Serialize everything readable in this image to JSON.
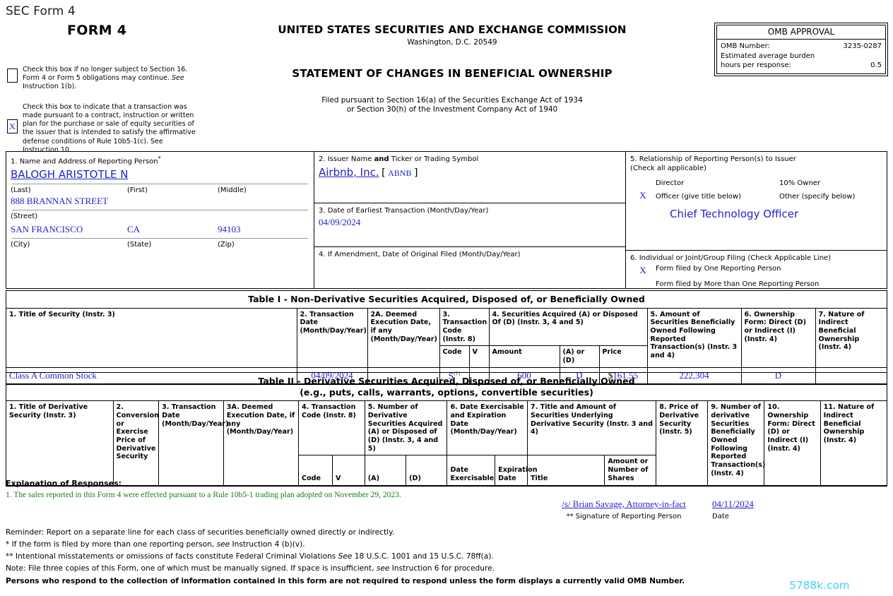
{
  "top_label": "SEC Form 4",
  "header": {
    "form_title": "FORM 4",
    "agency": "UNITED STATES SECURITIES AND EXCHANGE COMMISSION",
    "city": "Washington, D.C. 20549",
    "statement": "STATEMENT OF CHANGES IN BENEFICIAL OWNERSHIP",
    "filed_line1": "Filed pursuant to Section 16(a) of the Securities Exchange Act of 1934",
    "filed_line2": "or Section 30(h) of the Investment Company Act of 1940"
  },
  "omb": {
    "title": "OMB APPROVAL",
    "number_label": "OMB Number:",
    "number_value": "3235-0287",
    "burden_label": "Estimated average burden",
    "hours_label": "hours per response:",
    "hours_value": "0.5"
  },
  "checkboxes": {
    "box1": {
      "checked": "",
      "text": "Check this box if no longer subject to Section 16. Form 4 or Form 5 obligations may continue. See Instruction 1(b)."
    },
    "box2": {
      "checked": "X",
      "text": "Check this box to indicate that a transaction was made pursuant to a contract, instruction or written plan for the purchase or sale of equity securities of the issuer that is intended to satisfy the affirmative defense conditions of Rule 10b5-1(c). See Instruction 10."
    }
  },
  "box1": {
    "heading": "1. Name and Address of Reporting Person",
    "asterisk": "*",
    "person_name": "BALOGH ARISTOTLE N",
    "label_last": "(Last)",
    "label_first": "(First)",
    "label_middle": "(Middle)",
    "street": "888 BRANNAN STREET",
    "label_street": "(Street)",
    "city": "SAN FRANCISCO",
    "state": "CA",
    "zip": "94103",
    "label_city": "(City)",
    "label_state": "(State)",
    "label_zip": "(Zip)"
  },
  "box2": {
    "heading_pre": "2. Issuer Name ",
    "heading_bold": "and",
    "heading_post": " Ticker or Trading Symbol",
    "issuer_name": "Airbnb, Inc.",
    "bracket_open": "[",
    "ticker": "ABNB",
    "bracket_close": "]"
  },
  "box3": {
    "heading": "3. Date of Earliest Transaction (Month/Day/Year)",
    "value": "04/09/2024"
  },
  "box4": {
    "heading": "4. If Amendment, Date of Original Filed (Month/Day/Year)",
    "value": ""
  },
  "box5": {
    "heading_line1": "5. Relationship of Reporting Person(s) to Issuer",
    "heading_line2": "(Check all applicable)",
    "director_label": "Director",
    "director_x": "",
    "owner10_label": "10% Owner",
    "owner10_x": "",
    "officer_label": "Officer (give title below)",
    "officer_x": "X",
    "other_label": "Other (specify below)",
    "other_x": "",
    "officer_title": "Chief Technology Officer"
  },
  "box6": {
    "heading": "6. Individual or Joint/Group Filing (Check Applicable Line)",
    "one_x": "X",
    "one_label": "Form filed by One Reporting Person",
    "more_x": "",
    "more_label": "Form filed by More than One Reporting Person"
  },
  "table1": {
    "title": "Table I - Non-Derivative Securities Acquired, Disposed of, or Beneficially Owned",
    "headers": {
      "c1": "1. Title of Security (Instr. 3)",
      "c2": "2. Transaction Date (Month/Day/Year)",
      "c2a": "2A. Deemed Execution Date, if any (Month/Day/Year)",
      "c3": "3. Transaction Code (Instr. 8)",
      "c3_code": "Code",
      "c3_v": "V",
      "c4": "4. Securities Acquired (A) or Disposed Of (D) (Instr. 3, 4 and 5)",
      "c4_amount": "Amount",
      "c4_ad": "(A) or (D)",
      "c4_price": "Price",
      "c5": "5. Amount of Securities Beneficially Owned Following Reported Transaction(s) (Instr. 3 and 4)",
      "c6": "6. Ownership Form: Direct (D) or Indirect (I) (Instr. 4)",
      "c7": "7. Nature of Indirect Beneficial Ownership (Instr. 4)"
    },
    "rows": [
      {
        "security": "Class A Common Stock",
        "date": "04/09/2024",
        "deemed_date": "",
        "code": "S",
        "code_footnote": "(1)",
        "v": "",
        "amount": "600",
        "ad": "D",
        "price_symbol": "$",
        "price": "161.55",
        "owned_after": "222,304",
        "ownership_form": "D",
        "indirect_nature": ""
      }
    ]
  },
  "table2": {
    "title_line1": "Table II - Derivative Securities Acquired, Disposed of, or Beneficially Owned",
    "title_line2": "(e.g., puts, calls, warrants, options, convertible securities)",
    "headers": {
      "c1": "1. Title of Derivative Security (Instr. 3)",
      "c2": "2. Conversion or Exercise Price of Derivative Security",
      "c3": "3. Transaction Date (Month/Day/Year)",
      "c3a": "3A. Deemed Execution Date, if any (Month/Day/Year)",
      "c4": "4. Transaction Code (Instr. 8)",
      "c4_code": "Code",
      "c4_v": "V",
      "c5": "5. Number of Derivative Securities Acquired (A) or Disposed of (D) (Instr. 3, 4 and 5)",
      "c5_a": "(A)",
      "c5_d": "(D)",
      "c6": "6. Date Exercisable and Expiration Date (Month/Day/Year)",
      "c6_exercisable": "Date Exercisable",
      "c6_expiration": "Expiration Date",
      "c7": "7. Title and Amount of Securities Underlying Derivative Security (Instr. 3 and 4)",
      "c7_title": "Title",
      "c7_amount": "Amount or Number of Shares",
      "c8": "8. Price of Derivative Security (Instr. 5)",
      "c9": "9. Number of derivative Securities Beneficially Owned Following Reported Transaction(s) (Instr. 4)",
      "c10": "10. Ownership Form: Direct (D) or Indirect (I) (Instr. 4)",
      "c11": "11. Nature of Indirect Beneficial Ownership (Instr. 4)"
    },
    "rows": []
  },
  "footer": {
    "explanation_title": "Explanation of Responses:",
    "explanations": [
      "1. The sales reported in this Form 4 were effected pursuant to a Rule 10b5-1 trading plan adopted on November 29, 2023."
    ],
    "signature": "/s/ Brian Savage, Attorney-in-fact",
    "signature_date": "04/11/2024",
    "signature_label": "** Signature of Reporting Person",
    "date_label": "Date",
    "reminder": "Reminder: Report on a separate line for each class of securities beneficially owned directly or indirectly.",
    "note1_pre": "* If the form is filed by more than one reporting person, ",
    "note1_em": "see",
    "note1_post": " Instruction 4 (b)(v).",
    "note2_pre": "** Intentional misstatements or omissions of facts constitute Federal Criminal Violations ",
    "note2_em": "See",
    "note2_post": " 18 U.S.C. 1001 and 15 U.S.C. 78ff(a).",
    "note3_pre": "Note: File three copies of this Form, one of which must be manually signed. If space is insufficient, ",
    "note3_em": "see",
    "note3_post": " Instruction 6 for procedure.",
    "note4": "Persons who respond to the collection of information contained in this form are not required to respond unless the form displays a currently valid OMB Number."
  },
  "watermark": "5788k.com",
  "colors": {
    "link_blue": "#2222cc",
    "footnote_green": "#1a7a1a",
    "watermark": "#3fd0fc"
  }
}
